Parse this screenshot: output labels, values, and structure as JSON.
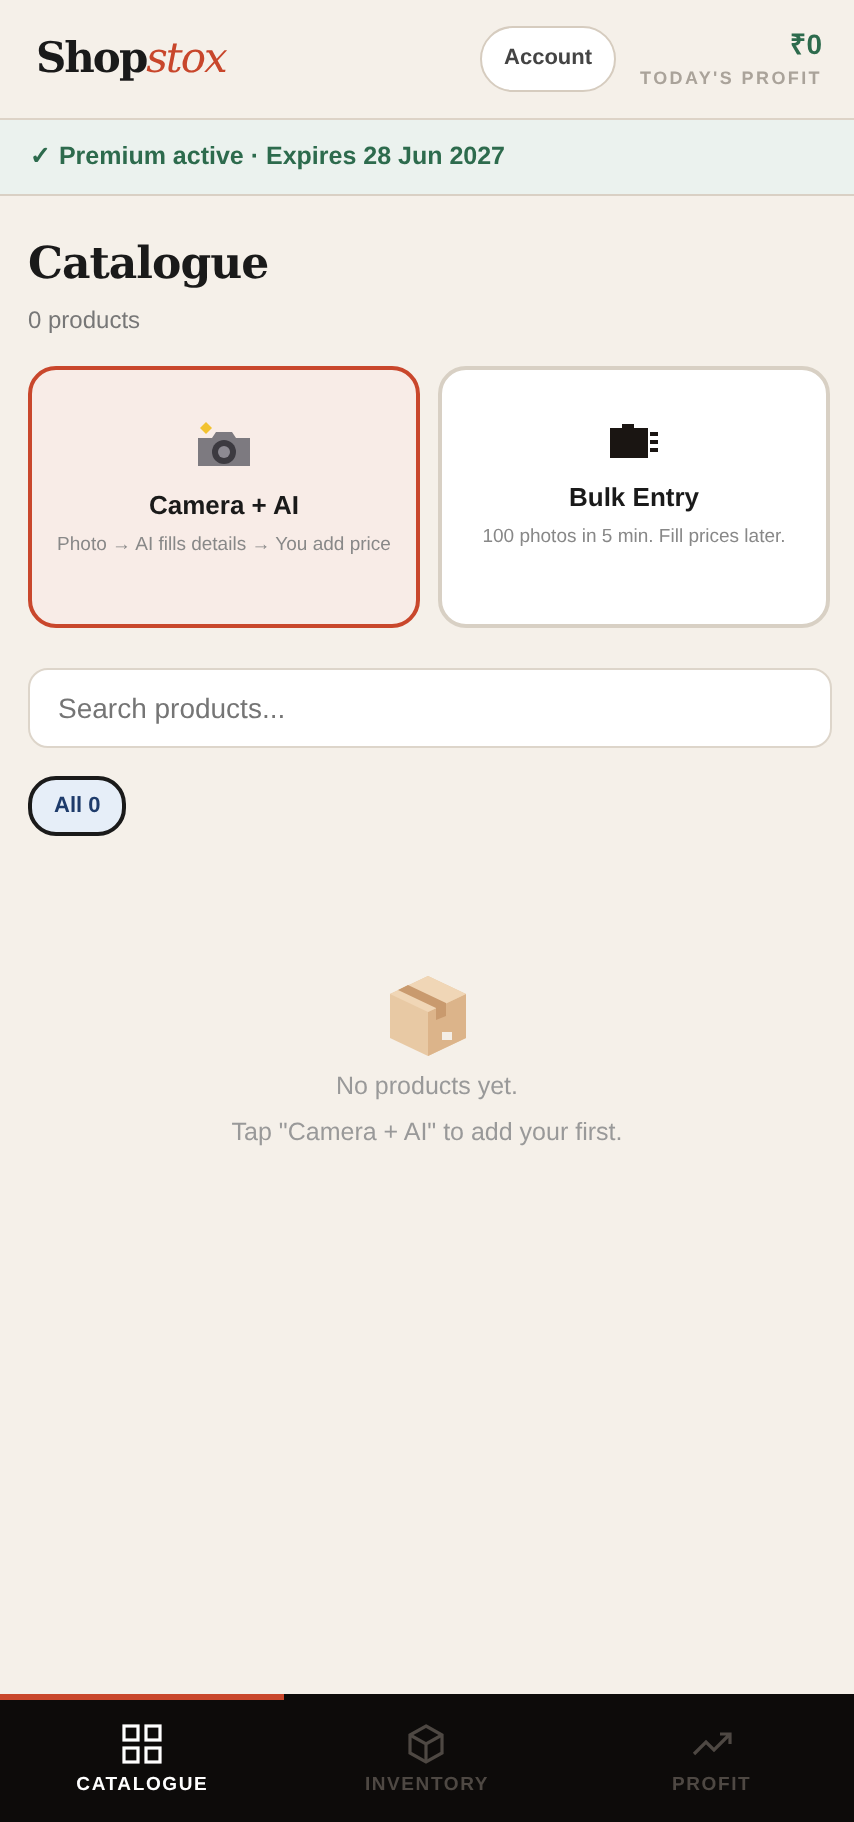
{
  "header": {
    "logo": {
      "main": "Shop",
      "accent": "stox"
    },
    "account_button": "Account",
    "profit_value": "₹0",
    "profit_label": "TODAY'S PROFIT"
  },
  "banner": "✓ Premium active · Expires 28 Jun 2027",
  "page": {
    "title": "Catalogue",
    "subtitle": "0 products"
  },
  "entry_cards": [
    {
      "kind": "camera",
      "title": "Camera + AI",
      "description": "Photo → AI fills details → You add price",
      "selected": true
    },
    {
      "kind": "bulk",
      "title": "Bulk Entry",
      "description": "100 photos in 5 min. Fill prices later.",
      "selected": false
    }
  ],
  "search": {
    "placeholder": "Search products..."
  },
  "filters": [
    {
      "label": "All 0",
      "selected": true
    }
  ],
  "empty_state": {
    "title": "No products yet.",
    "hint": "Tap \"Camera + AI\" to add your first."
  },
  "bottom_nav": [
    {
      "kind": "catalogue",
      "label": "CATALOGUE",
      "selected": true
    },
    {
      "kind": "inventory",
      "label": "INVENTORY",
      "selected": false
    },
    {
      "kind": "profit",
      "label": "PROFIT",
      "selected": false
    }
  ]
}
